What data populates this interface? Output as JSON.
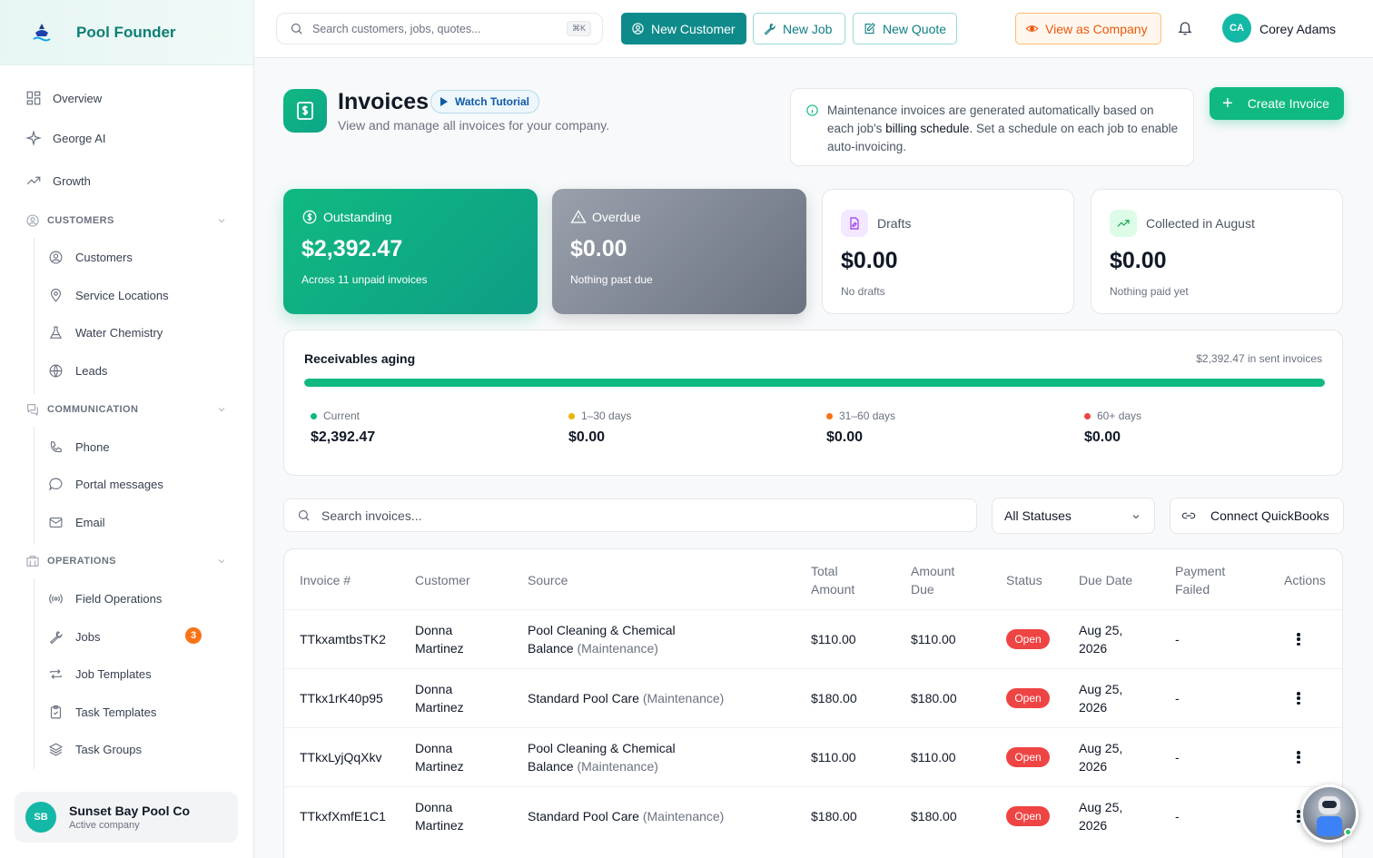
{
  "brand": {
    "name": "Pool Founder"
  },
  "sidebar": {
    "top_items": [
      {
        "label": "Overview"
      },
      {
        "label": "George AI"
      },
      {
        "label": "Growth"
      }
    ],
    "sections": [
      {
        "label": "CUSTOMERS",
        "items": [
          {
            "label": "Customers"
          },
          {
            "label": "Service Locations"
          },
          {
            "label": "Water Chemistry"
          },
          {
            "label": "Leads"
          }
        ]
      },
      {
        "label": "COMMUNICATION",
        "items": [
          {
            "label": "Phone"
          },
          {
            "label": "Portal messages"
          },
          {
            "label": "Email"
          }
        ]
      },
      {
        "label": "OPERATIONS",
        "items": [
          {
            "label": "Field Operations"
          },
          {
            "label": "Jobs",
            "badge": "3"
          },
          {
            "label": "Job Templates"
          },
          {
            "label": "Task Templates"
          },
          {
            "label": "Task Groups"
          }
        ]
      }
    ],
    "company": {
      "initials": "SB",
      "name": "Sunset Bay Pool Co",
      "status": "Active company"
    }
  },
  "topbar": {
    "search_placeholder": "Search customers, jobs, quotes...",
    "search_shortcut": "⌘K",
    "new_customer": "New Customer",
    "new_job": "New Job",
    "new_quote": "New Quote",
    "view_as_company": "View as Company",
    "user_initials": "CA",
    "user_name": "Corey Adams"
  },
  "page": {
    "title": "Invoices",
    "tutorial": "Watch Tutorial",
    "subtitle": "View and manage all invoices for your company.",
    "info_pre": "Maintenance invoices are generated automatically based on each job's ",
    "info_bold": "billing schedule",
    "info_post": ". Set a schedule on each job to enable auto-invoicing.",
    "create_button": "Create Invoice"
  },
  "stats": {
    "outstanding": {
      "label": "Outstanding",
      "amount": "$2,392.47",
      "sub": "Across 11 unpaid invoices"
    },
    "overdue": {
      "label": "Overdue",
      "amount": "$0.00",
      "sub": "Nothing past due"
    },
    "drafts": {
      "label": "Drafts",
      "amount": "$0.00",
      "sub": "No drafts"
    },
    "collected": {
      "label": "Collected in August",
      "amount": "$0.00",
      "sub": "Nothing paid yet"
    }
  },
  "aging": {
    "title": "Receivables aging",
    "total_label": "$2,392.47 in sent invoices",
    "current_fraction": 1.0,
    "buckets": [
      {
        "label": "Current",
        "value": "$2,392.47",
        "color": "#10b981"
      },
      {
        "label": "1–30 days",
        "value": "$0.00",
        "color": "#eab308"
      },
      {
        "label": "31–60 days",
        "value": "$0.00",
        "color": "#f97316"
      },
      {
        "label": "60+ days",
        "value": "$0.00",
        "color": "#ef4444"
      }
    ]
  },
  "filters": {
    "search_placeholder": "Search invoices...",
    "status": "All Statuses",
    "quickbooks": "Connect QuickBooks"
  },
  "table": {
    "headers": {
      "invoice": "Invoice #",
      "customer": "Customer",
      "source": "Source",
      "total_1": "Total",
      "total_2": "Amount",
      "due_1": "Amount",
      "due_2": "Due",
      "status": "Status",
      "due_date": "Due Date",
      "failed_1": "Payment",
      "failed_2": "Failed",
      "actions": "Actions"
    },
    "rows": [
      {
        "invoice": "TTkxamtbsTK2",
        "customer_1": "Donna",
        "customer_2": "Martinez",
        "source_1": "Pool Cleaning & Chemical",
        "source_2": "Balance",
        "source_type": "(Maintenance)",
        "total": "$110.00",
        "due": "$110.00",
        "status": "Open",
        "date_1": "Aug 25,",
        "date_2": "2026",
        "failed": "-"
      },
      {
        "invoice": "TTkx1rK40p95",
        "customer_1": "Donna",
        "customer_2": "Martinez",
        "source_1": "Standard Pool Care",
        "source_2": "",
        "source_type": "(Maintenance)",
        "total": "$180.00",
        "due": "$180.00",
        "status": "Open",
        "date_1": "Aug 25,",
        "date_2": "2026",
        "failed": "-"
      },
      {
        "invoice": "TTkxLyjQqXkv",
        "customer_1": "Donna",
        "customer_2": "Martinez",
        "source_1": "Pool Cleaning & Chemical",
        "source_2": "Balance",
        "source_type": "(Maintenance)",
        "total": "$110.00",
        "due": "$110.00",
        "status": "Open",
        "date_1": "Aug 25,",
        "date_2": "2026",
        "failed": "-"
      },
      {
        "invoice": "TTkxfXmfE1C1",
        "customer_1": "Donna",
        "customer_2": "Martinez",
        "source_1": "Standard Pool Care",
        "source_2": "",
        "source_type": "(Maintenance)",
        "total": "$180.00",
        "due": "$180.00",
        "status": "Open",
        "date_1": "Aug 25,",
        "date_2": "2026",
        "failed": "-"
      }
    ]
  }
}
